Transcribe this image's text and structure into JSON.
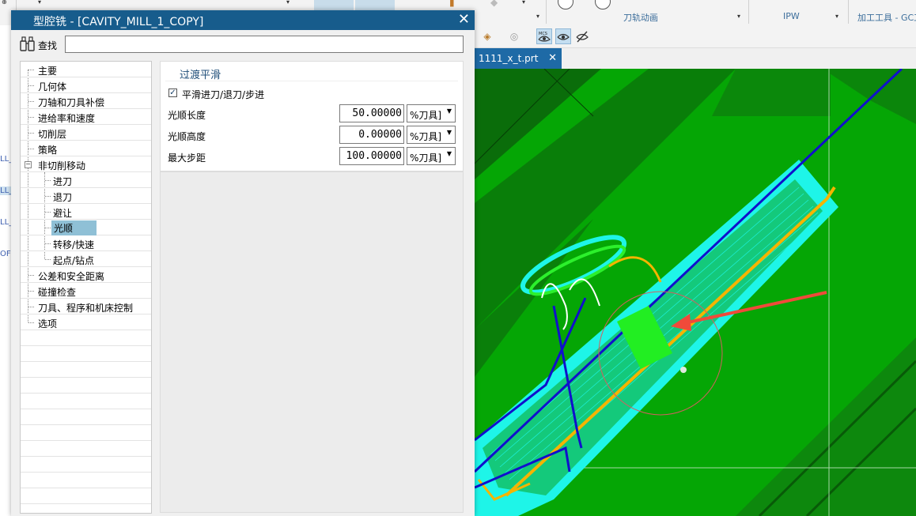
{
  "ribbon": {
    "groups": [
      "刀轨动画",
      "IPW",
      "加工工具 - GC工"
    ]
  },
  "left_strip": [
    "LL_",
    "LL_",
    "LL_",
    "OF"
  ],
  "file_tab": {
    "label": "1111_x_t.prt",
    "close": "✕"
  },
  "dialog": {
    "title": "型腔铣 - [CAVITY_MILL_1_COPY]",
    "close": "✕",
    "search_label": "查找",
    "search_value": ""
  },
  "tree": {
    "items": [
      {
        "label": "主要",
        "level": 0
      },
      {
        "label": "几何体",
        "level": 0
      },
      {
        "label": "刀轴和刀具补偿",
        "level": 0
      },
      {
        "label": "进给率和速度",
        "level": 0
      },
      {
        "label": "切削层",
        "level": 0
      },
      {
        "label": "策略",
        "level": 0
      },
      {
        "label": "非切削移动",
        "level": 0,
        "expander": "−"
      },
      {
        "label": "进刀",
        "level": 1
      },
      {
        "label": "退刀",
        "level": 1
      },
      {
        "label": "避让",
        "level": 1
      },
      {
        "label": "光顺",
        "level": 1,
        "selected": true
      },
      {
        "label": "转移/快速",
        "level": 1
      },
      {
        "label": "起点/钻点",
        "level": 1
      },
      {
        "label": "公差和安全距离",
        "level": 0
      },
      {
        "label": "碰撞检查",
        "level": 0
      },
      {
        "label": "刀具、程序和机床控制",
        "level": 0
      },
      {
        "label": "选项",
        "level": 0
      }
    ]
  },
  "panel": {
    "title": "过渡平滑",
    "checkbox_label": "平滑进刀/退刀/步进",
    "checkbox_checked": "✓",
    "fields": [
      {
        "label": "光顺长度",
        "value": "50.00000",
        "unit": "%刀具]"
      },
      {
        "label": "光顺高度",
        "value": "0.00000",
        "unit": "%刀具]"
      },
      {
        "label": "最大步距",
        "value": "100.00000",
        "unit": "%刀具]"
      }
    ]
  },
  "colors": {
    "title_bar": "#175c8c",
    "viewport_green": "#05a605",
    "toolpath_cyan": "#1ef5e8",
    "toolpath_blue": "#1010cc",
    "toolpath_orange": "#f5b400",
    "arrow_red": "#f04a3a"
  }
}
